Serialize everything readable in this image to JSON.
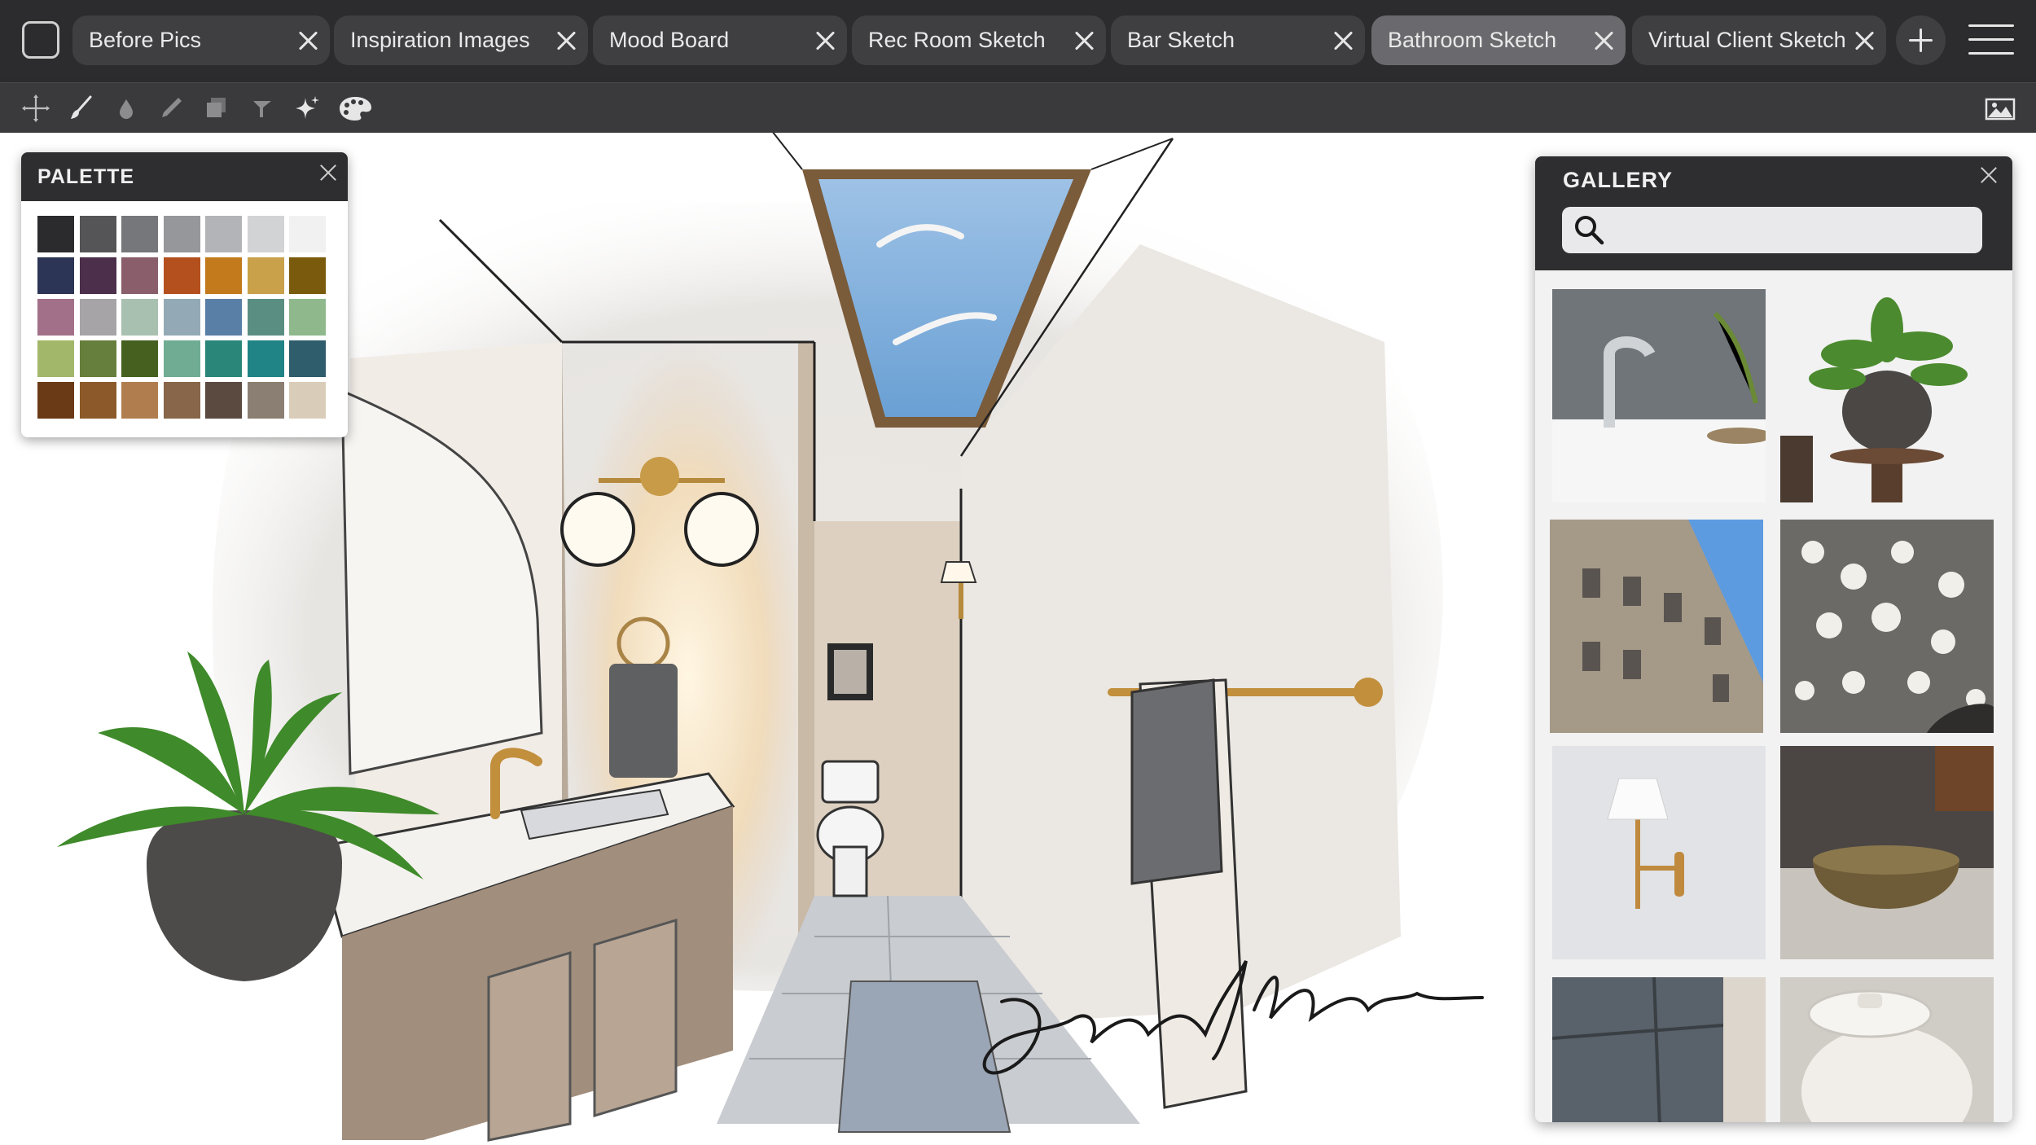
{
  "tabs": [
    {
      "label": "Before Pics",
      "active": false
    },
    {
      "label": "Inspiration Images",
      "active": false
    },
    {
      "label": "Mood Board",
      "active": false
    },
    {
      "label": "Rec Room Sketch",
      "active": false
    },
    {
      "label": "Bar Sketch",
      "active": false
    },
    {
      "label": "Bathroom Sketch",
      "active": true
    },
    {
      "label": "Virtual Client Sketch",
      "active": false
    }
  ],
  "toolbar": {
    "tools": [
      "move-icon",
      "brush-icon",
      "ink-drop-icon",
      "pencil-icon",
      "layers-icon",
      "eraser-icon",
      "sparkle-icon",
      "palette-icon"
    ],
    "right_tool": "image-icon"
  },
  "palette": {
    "title": "PALETTE",
    "colors": [
      "#2b2b2d",
      "#555558",
      "#76777a",
      "#96979a",
      "#b3b4b7",
      "#d2d3d5",
      "#f1f1f2",
      "#2d3556",
      "#4c2f4a",
      "#8a5e6b",
      "#b4501e",
      "#c27a1c",
      "#c9a14a",
      "#7a5a0c",
      "#a37089",
      "#a7a4a7",
      "#a8c0b0",
      "#93aab6",
      "#5a7fa6",
      "#5b8e83",
      "#8fb98d",
      "#a3b76a",
      "#667f3c",
      "#46611f",
      "#6fac93",
      "#2a8679",
      "#208385",
      "#2f5d6b",
      "#6a3a17",
      "#8c5a2a",
      "#b07e4e",
      "#876649",
      "#5b4a3f",
      "#8a7f72",
      "#d9cdb9"
    ]
  },
  "gallery": {
    "title": "GALLERY",
    "search_placeholder": "",
    "images": [
      "faucet-photo",
      "potted-plant-photo",
      "stone-building-photo",
      "babys-breath-photo",
      "wall-sconce-photo",
      "ceramic-bowl-photo",
      "slate-tile-photo",
      "lidded-jar-photo"
    ]
  },
  "canvas": {
    "sketch": "bathroom-sketch",
    "signature": "Emily Michelle"
  }
}
